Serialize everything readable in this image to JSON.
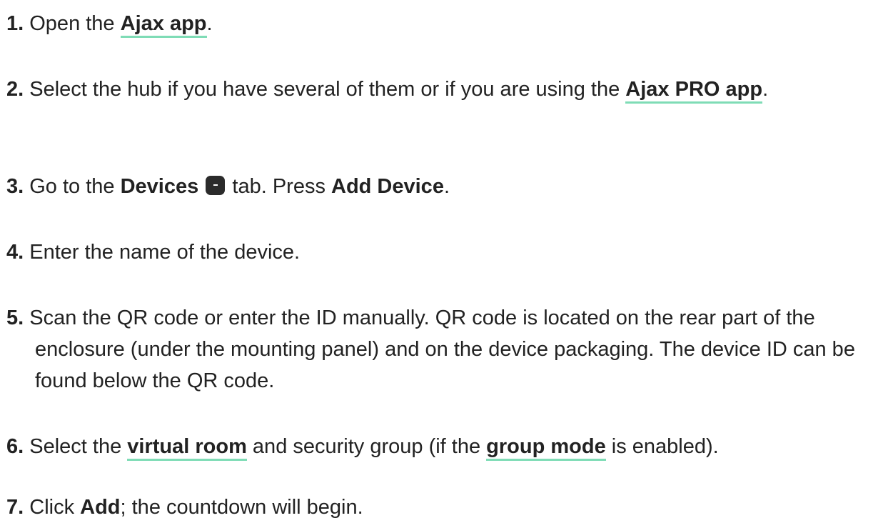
{
  "steps": [
    {
      "number": "1.",
      "t1": "Open the ",
      "link1": "Ajax app",
      "t2": "."
    },
    {
      "number": "2.",
      "t1": "Select the hub if you have several of them or if you are using the ",
      "link1": "Ajax PRO app",
      "t2": "."
    },
    {
      "number": "3.",
      "t1": "Go to the ",
      "b1": "Devices",
      "icon": "devices-tab-icon",
      "t2": " tab. Press ",
      "b2": "Add Device",
      "t3": "."
    },
    {
      "number": "4.",
      "t1": "Enter the name of the device."
    },
    {
      "number": "5.",
      "t1": "Scan the QR code or enter the ID manually. QR code is located on the rear part of the enclosure (under the mounting panel) and on the device packaging. The device ID can be found below the QR code."
    },
    {
      "number": "6.",
      "t1": "Select the ",
      "link1": "virtual room",
      "t2": " and security group (if the ",
      "link2": "group mode",
      "t3": " is enabled)."
    },
    {
      "number": "7.",
      "t1": "Click ",
      "b1": "Add",
      "t2": "; the countdown will begin."
    }
  ],
  "colors": {
    "text": "#222222",
    "link_underline": "#7fdcb6",
    "icon_bg": "#2b2b2b"
  }
}
